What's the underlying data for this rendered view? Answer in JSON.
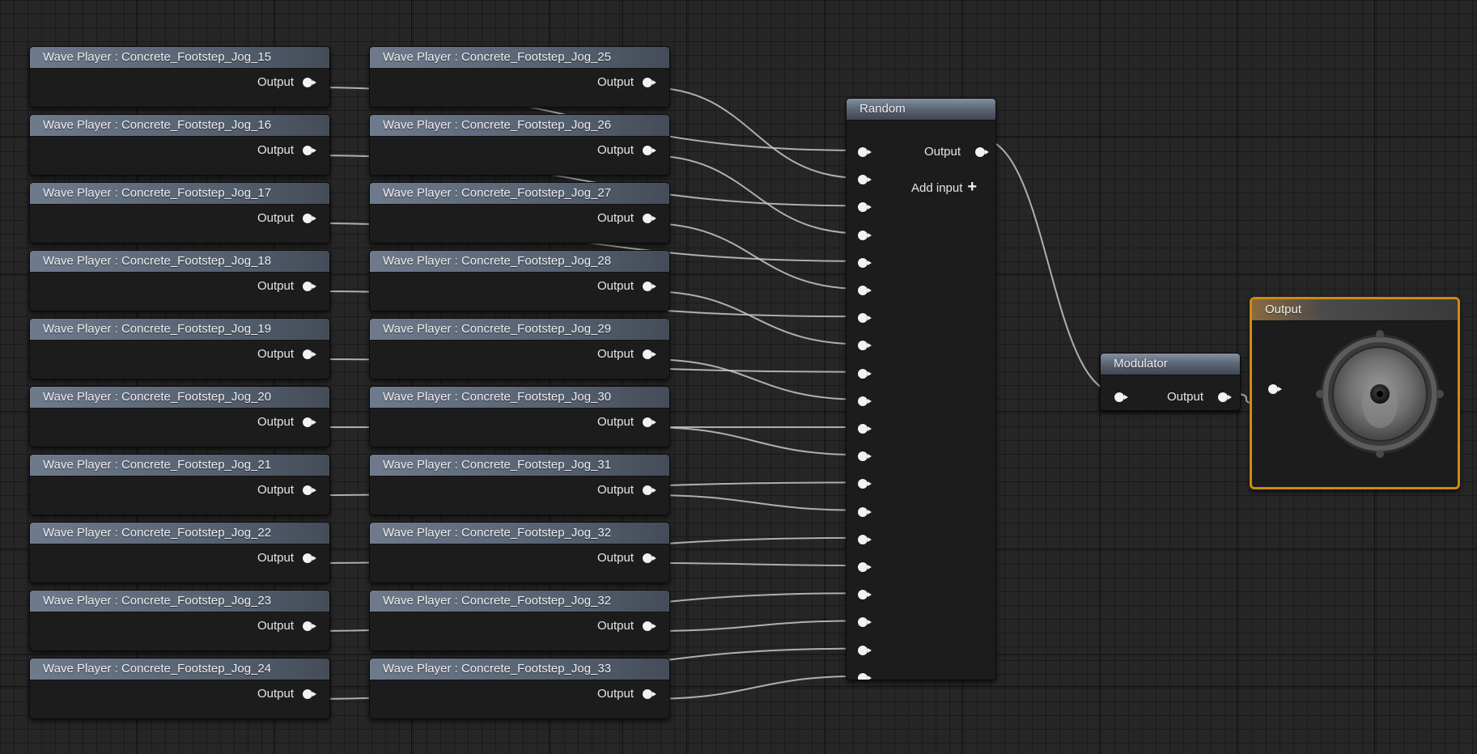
{
  "colors": {
    "background": "#262626",
    "wire": "#c8c8c8",
    "pin": "#f2f2f2",
    "selected_border": "#d08a10",
    "header_blue": "#5d6878"
  },
  "pin_label": "Output",
  "wave_players": [
    {
      "title": "Wave Player : Concrete_Footstep_Jog_15"
    },
    {
      "title": "Wave Player : Concrete_Footstep_Jog_16"
    },
    {
      "title": "Wave Player : Concrete_Footstep_Jog_17"
    },
    {
      "title": "Wave Player : Concrete_Footstep_Jog_18"
    },
    {
      "title": "Wave Player : Concrete_Footstep_Jog_19"
    },
    {
      "title": "Wave Player : Concrete_Footstep_Jog_20"
    },
    {
      "title": "Wave Player : Concrete_Footstep_Jog_21"
    },
    {
      "title": "Wave Player : Concrete_Footstep_Jog_22"
    },
    {
      "title": "Wave Player : Concrete_Footstep_Jog_23"
    },
    {
      "title": "Wave Player : Concrete_Footstep_Jog_24"
    },
    {
      "title": "Wave Player : Concrete_Footstep_Jog_25"
    },
    {
      "title": "Wave Player : Concrete_Footstep_Jog_26"
    },
    {
      "title": "Wave Player : Concrete_Footstep_Jog_27"
    },
    {
      "title": "Wave Player : Concrete_Footstep_Jog_28"
    },
    {
      "title": "Wave Player : Concrete_Footstep_Jog_29"
    },
    {
      "title": "Wave Player : Concrete_Footstep_Jog_30"
    },
    {
      "title": "Wave Player : Concrete_Footstep_Jog_31"
    },
    {
      "title": "Wave Player : Concrete_Footstep_Jog_32"
    },
    {
      "title": "Wave Player : Concrete_Footstep_Jog_32"
    },
    {
      "title": "Wave Player : Concrete_Footstep_Jog_33"
    }
  ],
  "random_node": {
    "title": "Random",
    "output_label": "Output",
    "add_input_label": "Add input",
    "input_count": 20
  },
  "modulator_node": {
    "title": "Modulator",
    "output_label": "Output"
  },
  "output_node": {
    "title": "Output",
    "icon": "speaker-icon"
  }
}
